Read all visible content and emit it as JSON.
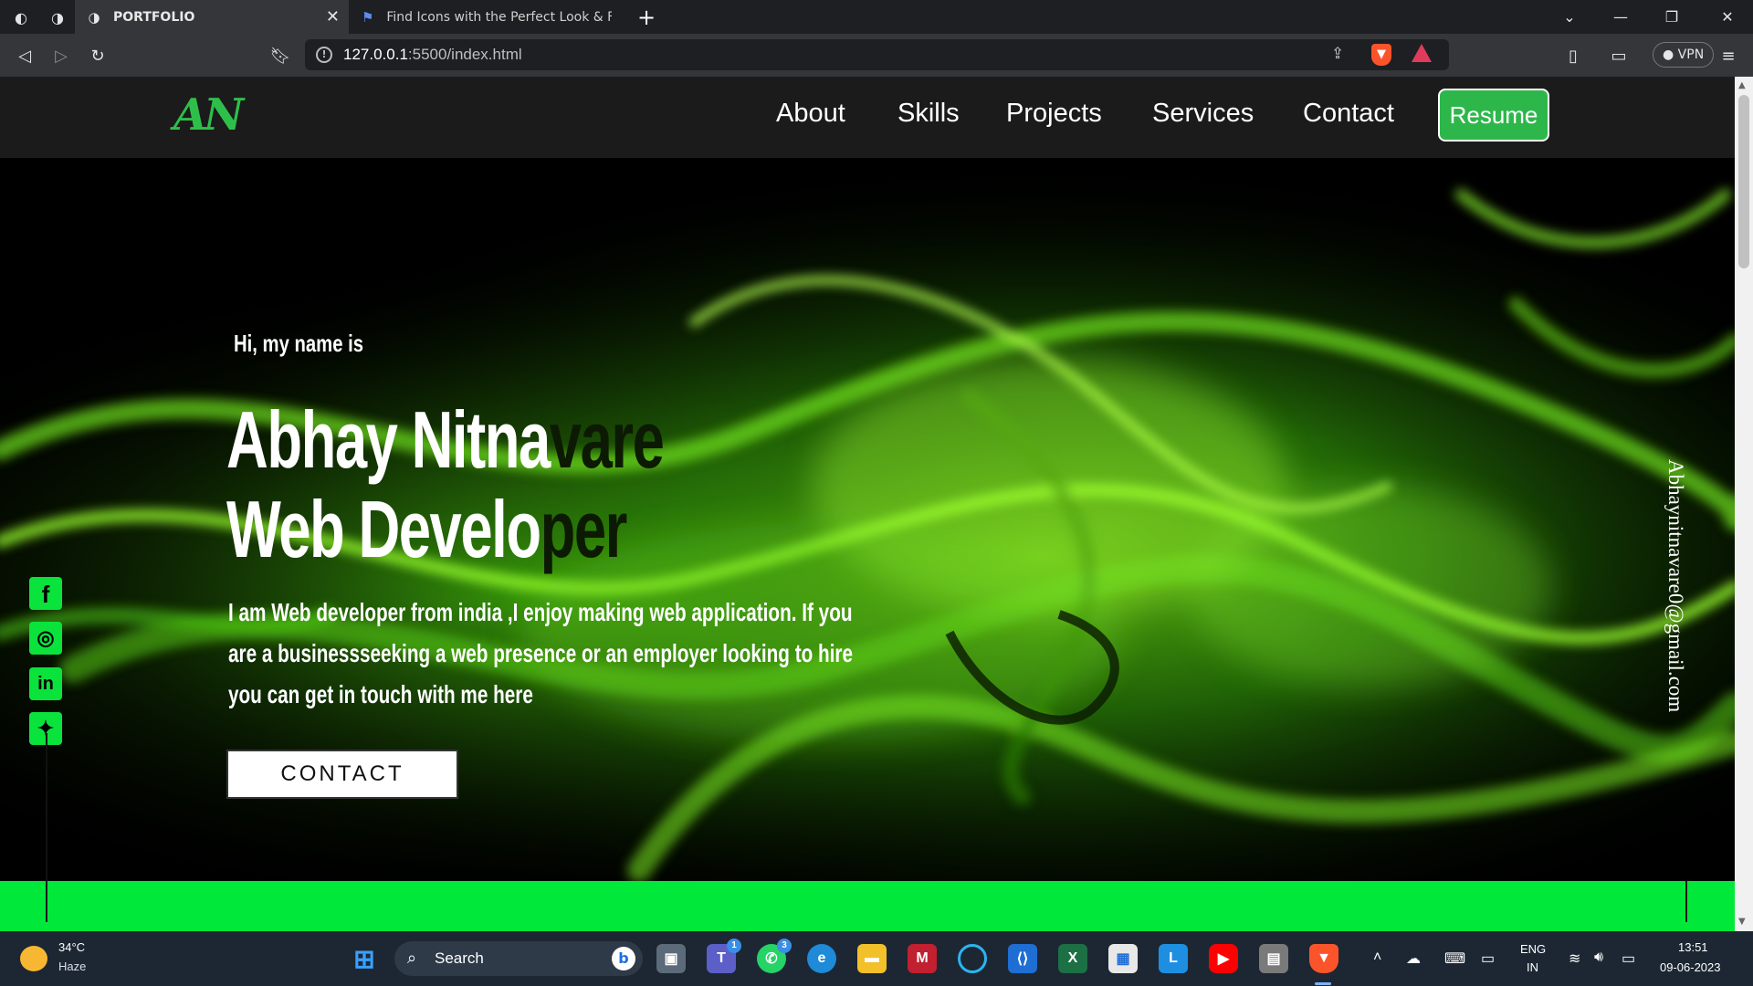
{
  "browser": {
    "tabs": [
      {
        "title": "PORTFOLIO",
        "active": true
      },
      {
        "title": "Find Icons with the Perfect Look & Fee",
        "active": false
      }
    ],
    "url": {
      "host": "127.0.0.1",
      "rest": ":5500/index.html"
    },
    "vpn_label": "VPN"
  },
  "site": {
    "logo": "AN",
    "nav": [
      "About",
      "Skills",
      "Projects",
      "Services",
      "Contact"
    ],
    "resume_label": "Resume",
    "hero": {
      "greeting": "Hi, my name is",
      "name_solid": "Abhay Nitna",
      "name_fade": "vare",
      "role_solid": "Web Develo",
      "role_fade": "per",
      "description": "I am Web developer from india ,I enjoy making web application. If you are a businessseeking a web presence or an employer looking to hire you can get in touch with me here",
      "contact_label": "CONTACT",
      "email": "Abhaynitnavare0@gmail.com"
    },
    "social": [
      "facebook-icon",
      "instagram-icon",
      "linkedin-icon",
      "twitter-icon"
    ],
    "accent_color": "#00e83a"
  },
  "taskbar": {
    "weather_temp": "34°C",
    "weather_cond": "Haze",
    "search_label": "Search",
    "teams_badge": "1",
    "whatsapp_badge": "3",
    "lang_top": "ENG",
    "lang_bottom": "IN",
    "time": "13:51",
    "date": "09-06-2023"
  }
}
